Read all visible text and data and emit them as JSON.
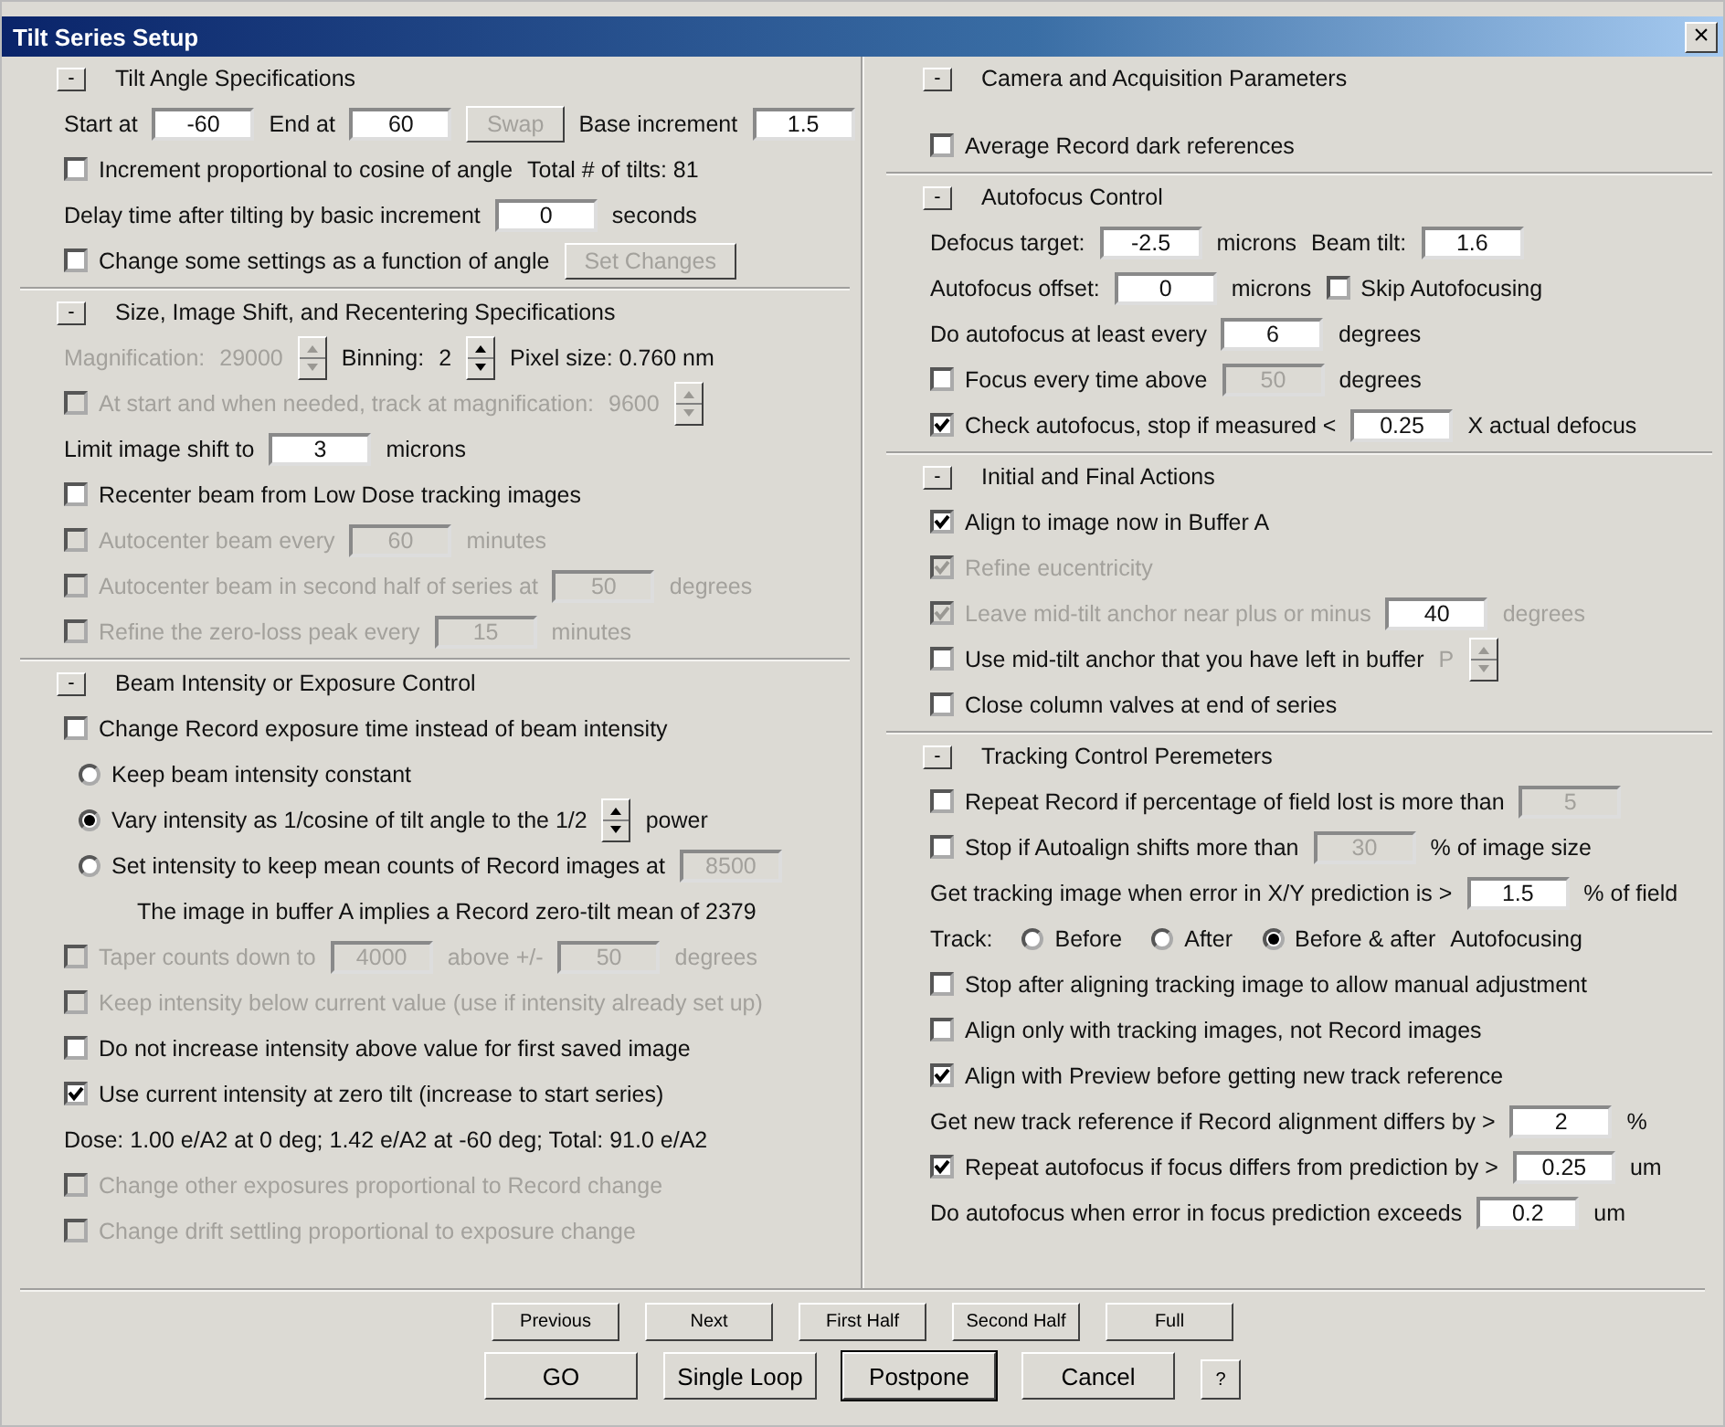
{
  "window": {
    "title": "Tilt Series Setup",
    "close": "×"
  },
  "columns": [
    [
      {
        "toggle": "-",
        "title": "Tilt Angle Specifications",
        "rows": [
          {
            "items": [
              {
                "kind": "label",
                "text": "Start at"
              },
              {
                "kind": "input",
                "value": "-60"
              },
              {
                "kind": "label",
                "text": "End at"
              },
              {
                "kind": "input",
                "value": "60"
              },
              {
                "kind": "button",
                "label": "Swap",
                "disabled": true
              },
              {
                "kind": "label",
                "text": "Base increment"
              },
              {
                "kind": "input",
                "value": "1.5"
              }
            ]
          },
          {
            "items": [
              {
                "kind": "check",
                "label": "Increment proportional to cosine of angle",
                "checked": false,
                "disabled": false
              },
              {
                "kind": "label",
                "text": "Total # of tilts: 81"
              }
            ]
          },
          {
            "items": [
              {
                "kind": "label",
                "text": "Delay time after tilting by basic increment"
              },
              {
                "kind": "input",
                "value": "0"
              },
              {
                "kind": "label",
                "text": "seconds"
              }
            ]
          },
          {
            "items": [
              {
                "kind": "check",
                "label": "Change some settings as a function of angle",
                "checked": false,
                "disabled": false
              },
              {
                "kind": "button",
                "label": "Set Changes",
                "disabled": true
              }
            ]
          }
        ]
      },
      {
        "toggle": "-",
        "title": "Size, Image Shift, and Recentering Specifications",
        "rows": [
          {
            "items": [
              {
                "kind": "label",
                "text": "Magnification:",
                "disabled": true
              },
              {
                "kind": "label",
                "text": "29000",
                "disabled": true
              },
              {
                "kind": "spin",
                "disabled": true
              },
              {
                "kind": "label",
                "text": "Binning:"
              },
              {
                "kind": "label",
                "text": "2"
              },
              {
                "kind": "spin",
                "disabled": false
              },
              {
                "kind": "label",
                "text": "Pixel size: 0.760 nm"
              }
            ]
          },
          {
            "items": [
              {
                "kind": "check",
                "label": "At start and when needed, track at magnification:",
                "checked": false,
                "disabled": true
              },
              {
                "kind": "label",
                "text": "9600",
                "disabled": true
              },
              {
                "kind": "spin",
                "disabled": true
              }
            ]
          },
          {
            "items": [
              {
                "kind": "label",
                "text": "Limit image shift to"
              },
              {
                "kind": "input",
                "value": "3"
              },
              {
                "kind": "label",
                "text": "microns"
              }
            ]
          },
          {
            "items": [
              {
                "kind": "check",
                "label": "Recenter beam from Low Dose tracking images",
                "checked": false,
                "disabled": false
              }
            ]
          },
          {
            "items": [
              {
                "kind": "check",
                "label": "Autocenter beam every",
                "checked": false,
                "disabled": true
              },
              {
                "kind": "input",
                "value": "60",
                "disabled": true
              },
              {
                "kind": "label",
                "text": "minutes",
                "disabled": true
              }
            ]
          },
          {
            "items": [
              {
                "kind": "check",
                "label": "Autocenter beam in second half of series at",
                "checked": false,
                "disabled": true
              },
              {
                "kind": "input",
                "value": "50",
                "disabled": true
              },
              {
                "kind": "label",
                "text": "degrees",
                "disabled": true
              }
            ]
          },
          {
            "items": [
              {
                "kind": "check",
                "label": "Refine the zero-loss peak every",
                "checked": false,
                "disabled": true
              },
              {
                "kind": "input",
                "value": "15",
                "disabled": true
              },
              {
                "kind": "label",
                "text": "minutes",
                "disabled": true
              }
            ]
          }
        ]
      },
      {
        "toggle": "-",
        "title": "Beam Intensity or Exposure Control",
        "rows": [
          {
            "items": [
              {
                "kind": "check",
                "label": "Change Record exposure time instead of beam intensity",
                "checked": false,
                "disabled": false
              }
            ]
          },
          {
            "items": [
              {
                "kind": "radio",
                "label": "Keep beam intensity constant",
                "selected": false
              }
            ]
          },
          {
            "items": [
              {
                "kind": "radio",
                "label": "Vary intensity as 1/cosine of tilt angle to the 1/2",
                "selected": true
              },
              {
                "kind": "spin",
                "disabled": false
              },
              {
                "kind": "label",
                "text": "power"
              }
            ]
          },
          {
            "items": [
              {
                "kind": "radio",
                "label": "Set intensity to keep mean counts of  Record images at",
                "selected": false
              },
              {
                "kind": "input",
                "value": "8500",
                "disabled": true
              }
            ]
          },
          {
            "items": [
              {
                "kind": "note",
                "text": "The image in buffer A implies a Record zero-tilt mean of 2379"
              }
            ]
          },
          {
            "items": [
              {
                "kind": "check",
                "label": "Taper counts down to",
                "checked": false,
                "disabled": true
              },
              {
                "kind": "input",
                "value": "4000",
                "disabled": true
              },
              {
                "kind": "label",
                "text": "above +/-",
                "disabled": true
              },
              {
                "kind": "input",
                "value": "50",
                "disabled": true
              },
              {
                "kind": "label",
                "text": "degrees",
                "disabled": true
              }
            ]
          },
          {
            "items": [
              {
                "kind": "check",
                "label": "Keep intensity below current value (use if intensity already set up)",
                "checked": false,
                "disabled": true
              }
            ]
          },
          {
            "items": [
              {
                "kind": "check",
                "label": "Do not increase intensity above value for first saved image",
                "checked": false,
                "disabled": false
              }
            ]
          },
          {
            "items": [
              {
                "kind": "check",
                "label": "Use current intensity at zero tilt (increase to start series)",
                "checked": true,
                "disabled": false
              }
            ]
          },
          {
            "items": [
              {
                "kind": "label",
                "text": "Dose: 1.00 e/A2 at 0 deg; 1.42 e/A2 at -60 deg; Total: 91.0 e/A2"
              }
            ]
          },
          {
            "items": [
              {
                "kind": "check",
                "label": "Change other exposures proportional to Record change",
                "checked": false,
                "disabled": true
              }
            ]
          },
          {
            "items": [
              {
                "kind": "check",
                "label": "Change drift settling proportional to exposure change",
                "checked": false,
                "disabled": true
              }
            ]
          }
        ]
      }
    ],
    [
      {
        "toggle": "-",
        "title": "Camera and Acquisition Parameters",
        "rows": [
          {
            "items": [
              {
                "kind": "check",
                "label": "Average Record dark references",
                "checked": false,
                "disabled": false
              }
            ]
          }
        ]
      },
      {
        "toggle": "-",
        "title": "Autofocus Control",
        "rows": [
          {
            "items": [
              {
                "kind": "label",
                "text": "Defocus target:"
              },
              {
                "kind": "input",
                "value": "-2.5"
              },
              {
                "kind": "label",
                "text": "microns"
              },
              {
                "kind": "label",
                "text": "Beam tilt:"
              },
              {
                "kind": "input",
                "value": "1.6"
              }
            ]
          },
          {
            "items": [
              {
                "kind": "label",
                "text": "Autofocus offset:"
              },
              {
                "kind": "input",
                "value": "0"
              },
              {
                "kind": "label",
                "text": "microns"
              },
              {
                "kind": "check",
                "label": "Skip Autofocusing",
                "checked": false,
                "disabled": false
              }
            ]
          },
          {
            "items": [
              {
                "kind": "label",
                "text": "Do autofocus at least every"
              },
              {
                "kind": "input",
                "value": "6"
              },
              {
                "kind": "label",
                "text": "degrees"
              }
            ]
          },
          {
            "items": [
              {
                "kind": "check",
                "label": "Focus every time above",
                "checked": false,
                "disabled": false
              },
              {
                "kind": "input",
                "value": "50",
                "disabled": true
              },
              {
                "kind": "label",
                "text": "degrees"
              }
            ]
          },
          {
            "items": [
              {
                "kind": "check",
                "label": "Check autofocus, stop if measured <",
                "checked": true,
                "disabled": false
              },
              {
                "kind": "input",
                "value": "0.25"
              },
              {
                "kind": "label",
                "text": "X actual defocus"
              }
            ]
          }
        ]
      },
      {
        "toggle": "-",
        "title": "Initial and Final Actions",
        "rows": [
          {
            "items": [
              {
                "kind": "check",
                "label": "Align to image now in Buffer A",
                "checked": true,
                "disabled": false
              }
            ]
          },
          {
            "items": [
              {
                "kind": "check",
                "label": "Refine eucentricity",
                "checked": true,
                "disabled": true
              }
            ]
          },
          {
            "items": [
              {
                "kind": "check",
                "label": "Leave mid-tilt anchor near plus or minus",
                "checked": true,
                "disabled": true
              },
              {
                "kind": "input",
                "value": "40"
              },
              {
                "kind": "label",
                "text": "degrees",
                "disabled": true
              }
            ]
          },
          {
            "items": [
              {
                "kind": "check",
                "label": "Use mid-tilt anchor that you have left in buffer",
                "checked": false,
                "disabled": false
              },
              {
                "kind": "label",
                "text": "P",
                "disabled": true
              },
              {
                "kind": "spin",
                "disabled": true
              }
            ]
          },
          {
            "items": [
              {
                "kind": "check",
                "label": "Close column valves at end of series",
                "checked": false,
                "disabled": false
              }
            ]
          }
        ]
      },
      {
        "toggle": "-",
        "title": "Tracking Control Peremeters",
        "rows": [
          {
            "items": [
              {
                "kind": "check",
                "label": "Repeat Record if percentage of field lost is more than",
                "checked": false,
                "disabled": false
              },
              {
                "kind": "input",
                "value": "5",
                "disabled": true
              }
            ]
          },
          {
            "items": [
              {
                "kind": "check",
                "label": "Stop if Autoalign shifts more than",
                "checked": false,
                "disabled": false
              },
              {
                "kind": "input",
                "value": "30",
                "disabled": true
              },
              {
                "kind": "label",
                "text": "% of image size"
              }
            ]
          },
          {
            "items": [
              {
                "kind": "label",
                "text": "Get tracking image when error in X/Y prediction is >"
              },
              {
                "kind": "input",
                "value": "1.5"
              },
              {
                "kind": "label",
                "text": "% of field"
              }
            ]
          },
          {
            "items": [
              {
                "kind": "label",
                "text": "Track:"
              },
              {
                "kind": "radio",
                "label": "Before",
                "selected": false
              },
              {
                "kind": "radio",
                "label": "After",
                "selected": false
              },
              {
                "kind": "radio",
                "label": "Before & after",
                "selected": true
              },
              {
                "kind": "label",
                "text": "Autofocusing"
              }
            ]
          },
          {
            "items": [
              {
                "kind": "check",
                "label": "Stop after aligning tracking image to allow manual adjustment",
                "checked": false,
                "disabled": false
              }
            ]
          },
          {
            "items": [
              {
                "kind": "check",
                "label": "Align only with tracking images, not Record images",
                "checked": false,
                "disabled": false
              }
            ]
          },
          {
            "items": [
              {
                "kind": "check",
                "label": "Align with Preview before getting new track reference",
                "checked": true,
                "disabled": false
              }
            ]
          },
          {
            "items": [
              {
                "kind": "label",
                "text": "Get new track reference if Record alignment differs by >"
              },
              {
                "kind": "input",
                "value": "2"
              },
              {
                "kind": "label",
                "text": "%"
              }
            ]
          },
          {
            "items": [
              {
                "kind": "check",
                "label": "Repeat autofocus if focus differs from prediction by >",
                "checked": true,
                "disabled": false
              },
              {
                "kind": "input",
                "value": "0.25"
              },
              {
                "kind": "label",
                "text": "um"
              }
            ]
          },
          {
            "items": [
              {
                "kind": "label",
                "text": "Do autofocus when error in focus prediction exceeds"
              },
              {
                "kind": "input",
                "value": "0.2"
              },
              {
                "kind": "label",
                "text": "um"
              }
            ]
          }
        ]
      }
    ]
  ],
  "nav_buttons": [
    "Previous",
    "Next",
    "First Half",
    "Second Half",
    "Full"
  ],
  "action_buttons": [
    {
      "label": "GO",
      "default": false
    },
    {
      "label": "Single Loop",
      "default": false
    },
    {
      "label": "Postpone",
      "default": true
    },
    {
      "label": "Cancel",
      "default": false
    },
    {
      "label": "?",
      "default": false
    }
  ]
}
